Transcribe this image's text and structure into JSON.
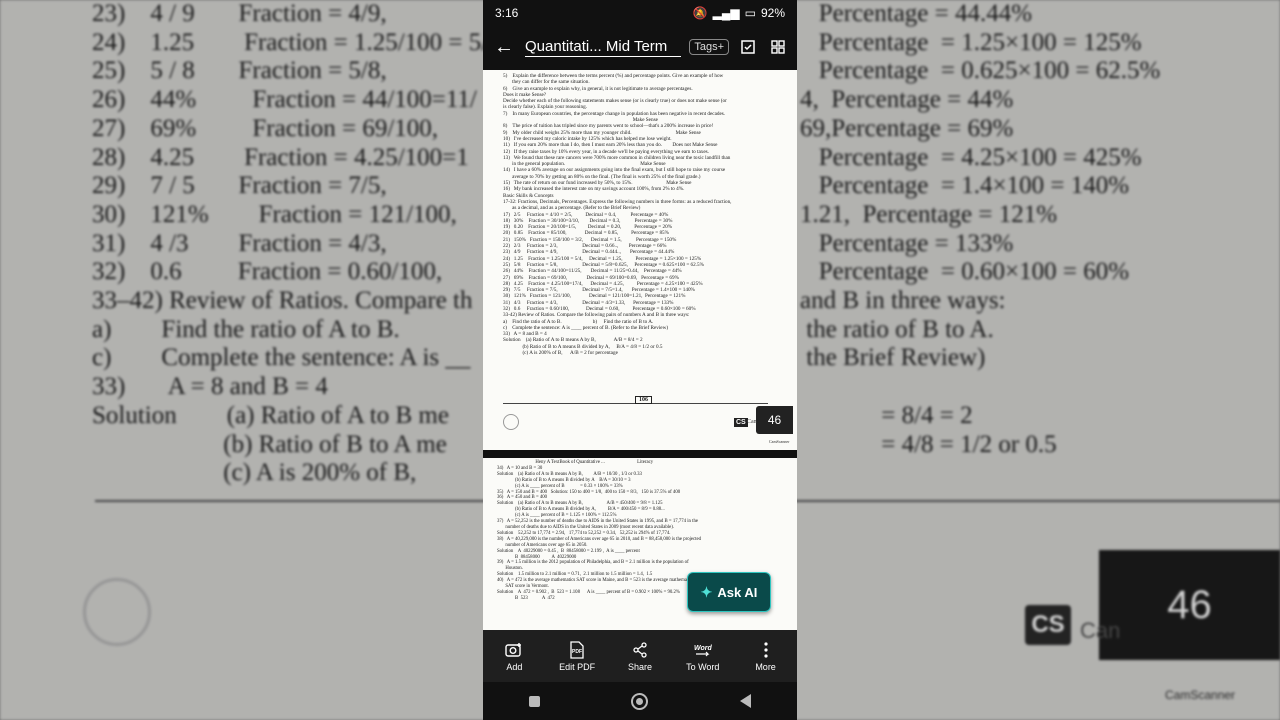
{
  "status_bar": {
    "time": "3:16",
    "battery": "92%"
  },
  "app_bar": {
    "title": "Quantitati... Mid Term",
    "tags_label": "Tags+"
  },
  "document": {
    "page1_text": "5)    Explain the difference between the terms percent (%) and percentage points. Give an example of how\n       they can differ for the same situation.\n6)    Give an example to explain why, in general, it is not legitimate to average percentages.\nDoes it make Sense?\nDecide whether each of the following statements makes sense (or is clearly true) or does not make sense (or\nis clearly false). Explain your reasoning.\n7)    In many European countries, the percentage change in population has been negative in recent decades.\n                                                                                                    Make Sense\n8)    The price of tuition has tripled since my parents went to school—that's a 200% increase in price!\n9)    My older child weighs 25% more than my younger child.                                  Make Sense\n10)   I've decreased my caloric intake by 125% which has helped me lose weight.\n11)   If you earn 20% more than I do, then I must earn 20% less than you do.        Does not Make Sense\n12)   If they raise taxes by 10% every year, in a decade we'll be paying everything we earn to taxes.\n13)   We found that these rare cancers were 700% more common in children living near the toxic landfill than\n       in the general population.                                                          Make Sense\n14)   I have a 60% average on our assignments going into the final exam, but I still hope to raise my course\n       average to 70% by getting an 80% on the final. (The final is worth 25% of the final grade.)\n15)   The rate of return on our fund increased by 50%, to 15%.                          Make Sense\n16)   My bank increased the interest rate on my savings account 100%, from 2% to 4%.\nBasic Skills & Concepts\n17-32: Fractions, Decimals, Percentages. Express the following numbers in three forms: as a reduced fraction,\n       as a decimal, and as a percentage. (Refer to the Brief Review)\n17)   2/5     Fraction = 4/10 = 2/5,          Decimal = 0.4,           Percentage = 40%\n18)   30%    Fraction = 30/100=3/10,        Decimal = 0.3,           Percentage = 30%\n19)   0.20    Fraction = 20/100=1/5,         Decimal = 0.20,          Percentage = 20%\n20)   0.85    Fraction = 85/100,              Decimal = 0.85,          Percentage = 85%\n21)   150%   Fraction = 150/100 = 3/2,      Decimal = 1.5,           Percentage = 150%\n22)   2/3     Fraction = 2/3,                   Decimal = 0.66..,        Percentage = 66%\n23)   4/9     Fraction = 4/9,                   Decimal = 0.444..,       Percentage = 44.44%\n24)   1.25    Fraction = 1.25/100 = 5/4,     Decimal = 1.25,          Percentage = 1.25×100 = 125%\n25)   5/8     Fraction = 5/8,                   Decimal = 5/8=0.625,     Percentage = 0.625×100 = 62.5%\n26)   44%    Fraction = 44/100=11/25,       Decimal = 11/25=0.44,    Percentage = 44%\n27)   69%    Fraction = 69/100,               Decimal = 69/100=0.69,   Percentage = 69%\n28)   4.25    Fraction = 4.25/100=17/4,      Decimal = 4.25,          Percentage = 4.25×100 = 425%\n29)   7/5     Fraction = 7/5,                   Decimal = 7/5=1.4,       Percentage = 1.4×100 = 140%\n30)   121%   Fraction = 121/100,              Decimal = 121/100=1.21,  Percentage = 121%\n31)   4/3     Fraction = 4/3,                   Decimal = 4/3=1.33,      Percentage = 133%\n32)   0.6     Fraction = 0.60/100,             Decimal = 0.60,          Percentage = 0.60×100 = 60%\n33-42) Review of Ratios. Compare the following pairs of numbers A and B in three ways:\na)    Find the ratio of A to B.                        b)     Find the ratio of B to A.\nc)    Complete the sentence: A is ____ percent of B. (Refer to the Brief Review)\n33)   A = 8 and B = 4\nSolution    (a) Ratio of A to B means A by B,              A/B = 8/4 = 2\n               (b) Ratio of B to A means B divided by A,     B/A = 4/8 = 1/2 or 0.5\n               (c) A is 200% of B,      A/B = 2 for percentage",
    "page_number": "106",
    "page_badge": "46",
    "cs_logo": "CS",
    "cam_text": "Can",
    "cs_small": "CamScanner",
    "page2_text": "                                Heny A TextBook of Quantitative ...                           Literacy\n34)   A = 10 and B = 30\nSolution    (a) Ratio of A to B means A by B,         A/B = 10/30 , 1/3 or 0.33\n               (b) Ratio of B to A means B divided by A    B/A = 30/10 = 3\n               (c) A is ____ percent of B             = 0.33 × 100% = 33%\n35)   A = 150 and B = 400   Solution: 150 to 400 = 1/8,  400 to 150 = 8/3,   150 is 37.5% of 400\n36)   A = 450 and B = 400\nSolution    (a) Ratio of A to B means A by B,                    A/B = 450/400 = 9/8 = 1.125\n               (b) Ratio of B to A means B divided by A,          B/A = 400/450 = 8/9 = 0.88...\n               (c) A is ____ percent of B = 1.125 × 100% = 112.5%\n37)   A = 52,252 is the number of deaths due to AIDS in the United States in 1995, and B = 17,774 in the\n       number of deaths due to AIDS in the United States in 2009 (most recent data available).\nSolution    52,252 to 17,774 = 2.94,   17,774 to 52,252 = 0.34,   52,252 is 294% of 17,774.\n38)   A = 40,229,000 is the number of Americans over age 65 in 2010, and B = 88,458,000 is the projected\n       number of Americans over age 65 in 2050.\nSolution    A  40229000 = 0.45 ,  B  88458000 = 2.199 ,  A is ____ percent\n               B  88458000          A  40229000\n39)   A = 1.5 million is the 2012 population of Philadelphia, and B = 2.1 million is the population of\n       Houston.\nSolution    1.5 million to 2.1 million = 0.71,  2.1 million to 1.5 million = 1.4,  1.5\n40)   A = 472 is the average mathematics SAT score in Maine, and B = 523 is the average mathematics\n       SAT score in Vermont.\nSolution    A  472 = 0.902 ,  B  523 = 1.108      A is ____ percent of B = 0.902 × 100% = 90.2%\n               B  523            A  472"
  },
  "ask_ai": {
    "label": "Ask AI"
  },
  "toolbar": [
    {
      "label": "Add",
      "icon": "add-photo-icon"
    },
    {
      "label": "Edit PDF",
      "icon": "pdf-icon"
    },
    {
      "label": "Share",
      "icon": "share-icon"
    },
    {
      "label": "To Word",
      "icon": "word-icon"
    },
    {
      "label": "More",
      "icon": "more-vertical-icon"
    }
  ],
  "background": {
    "left_text": "23)    4 / 9       Fraction = 4/9,\n24)    1.25        Fraction = 1.25/100 = 5/4,\n25)    5 / 8       Fraction = 5/8,\n26)    44%         Fraction = 44/100=11/\n27)    69%         Fraction = 69/100,\n28)    4.25        Fraction = 4.25/100=1\n29)    7 / 5       Fraction = 7/5,\n30)    121%        Fraction = 121/100,\n31)    4 /3        Fraction = 4/3,\n32)    0.6         Fraction = 0.60/100,\n33–42) Review of Ratios. Compare th\na)        Find the ratio of A to B.\nc)        Complete the sentence: A is __\n33)       A = 8 and B = 4\nSolution        (a) Ratio of A to B me\n                     (b) Ratio of B to A me\n                     (c) A is 200% of B,",
    "right_text": "   Percentage = 44.44%\n   Percentage  = 1.25×100 = 125%\n   Percentage  = 0.625×100 = 62.5%\n4,  Percentage = 44%\n69,Percentage = 69%\n   Percentage  = 4.25×100 = 425%\n   Percentage  = 1.4×100 = 140%\n1.21,  Percentage = 121%\n   Percentage = 133%\n   Percentage  = 0.60×100 = 60%\nand B in three ways:\n the ratio of B to A.\n the Brief Review)\n\n             = 8/4 = 2\n             = 4/8 = 1/2 or 0.5",
    "badge": "46",
    "cs": "CS",
    "cam": "Can",
    "cs_small": "CamScanner"
  }
}
